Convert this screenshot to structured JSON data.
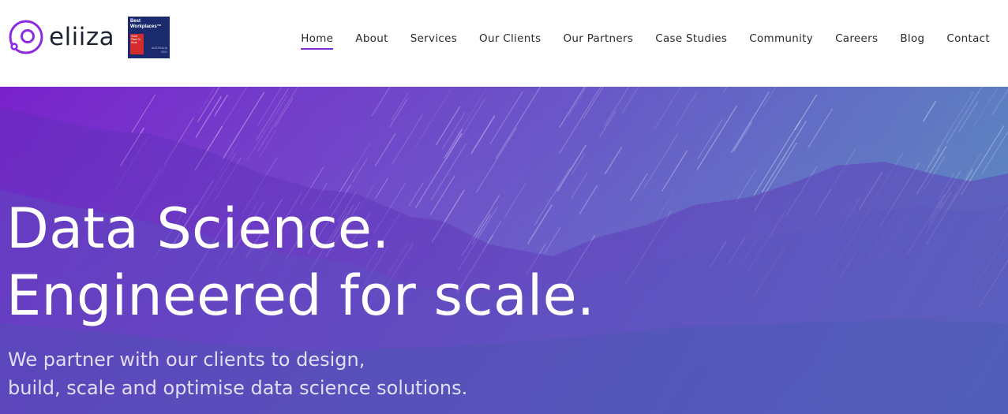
{
  "header": {
    "logo_text": "eliiza",
    "badge": {
      "title": "Best Workplaces™",
      "tag": "Great Place To Work.",
      "country": "AUSTRALIA",
      "year": "2021"
    }
  },
  "nav": {
    "items": [
      {
        "label": "Home",
        "active": true
      },
      {
        "label": "About"
      },
      {
        "label": "Services"
      },
      {
        "label": "Our Clients"
      },
      {
        "label": "Our Partners"
      },
      {
        "label": "Case Studies"
      },
      {
        "label": "Community"
      },
      {
        "label": "Careers"
      },
      {
        "label": "Blog"
      },
      {
        "label": "Contact"
      }
    ]
  },
  "hero": {
    "headline_line1": "Data Science.",
    "headline_line2": "Engineered for scale.",
    "sub_line1": "We partner with our clients to design,",
    "sub_line2": "build, scale and optimise data science solutions."
  },
  "colors": {
    "accent": "#7b2fd0",
    "brand_text": "#1f2433",
    "hero_gradient_start": "#7a22cc",
    "hero_gradient_end": "#4f86bb"
  }
}
